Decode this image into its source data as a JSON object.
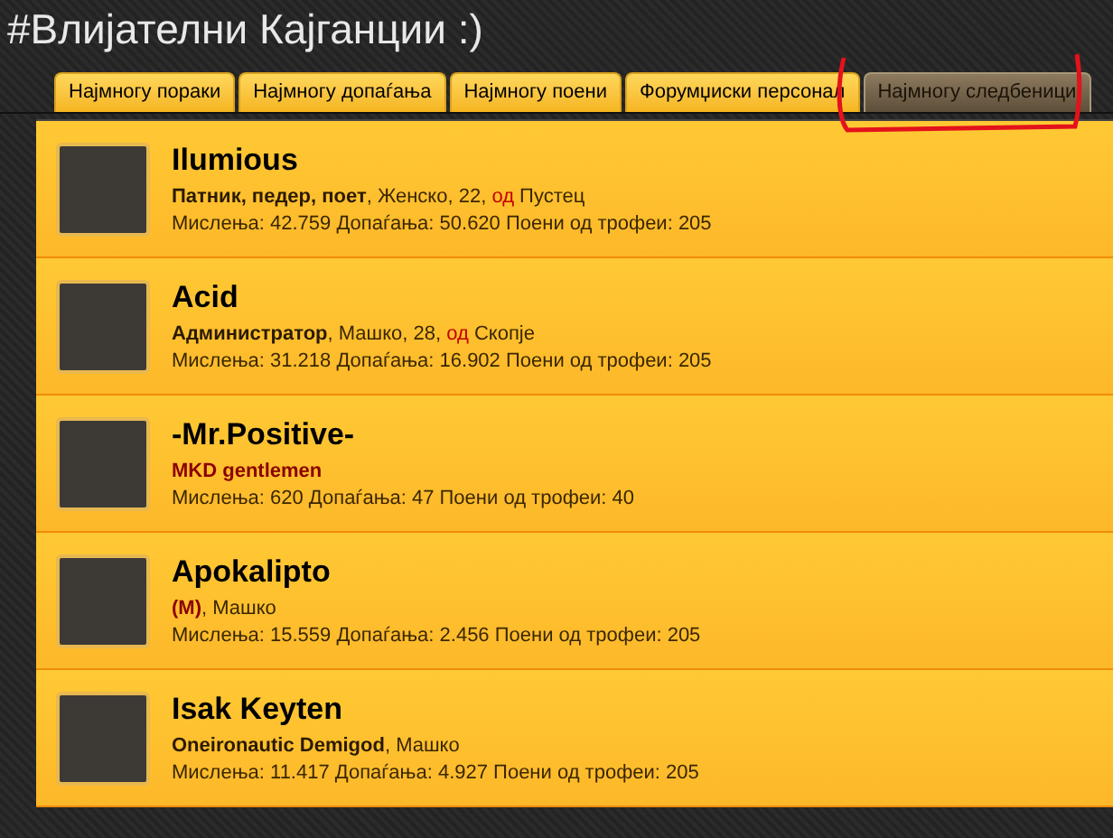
{
  "title": "#Влијателни Кајганции :)",
  "tabs": [
    {
      "label": "Најмногу пораки",
      "selected": false
    },
    {
      "label": "Најмногу допаѓања",
      "selected": false
    },
    {
      "label": "Најмногу поени",
      "selected": false
    },
    {
      "label": "Форумџиски персонал",
      "selected": false
    },
    {
      "label": "Најмногу следбеници",
      "selected": true
    }
  ],
  "users": [
    {
      "name": "Ilumious",
      "details": [
        {
          "kind": "title",
          "text": "Патник, педер, поет",
          "color": "#2a1a00"
        },
        {
          "kind": "text",
          "text": ", Женско, 22, "
        },
        {
          "kind": "from",
          "text": "од"
        },
        {
          "kind": "text",
          "text": " Пустец"
        }
      ],
      "stats": "Мислења: 42.759 Допаѓања: 50.620 Поени од трофеи: 205"
    },
    {
      "name": "Acid",
      "details": [
        {
          "kind": "title",
          "text": "Администратор",
          "color": "#2a1a00"
        },
        {
          "kind": "text",
          "text": ", Машко, 28, "
        },
        {
          "kind": "from",
          "text": "од"
        },
        {
          "kind": "text",
          "text": " Скопје"
        }
      ],
      "stats": "Мислења: 31.218 Допаѓања: 16.902 Поени од трофеи: 205"
    },
    {
      "name": "-Mr.Positive-",
      "details": [
        {
          "kind": "title",
          "text": "MKD gentlemen",
          "color": "#8b0000"
        }
      ],
      "stats": "Мислења: 620 Допаѓања: 47 Поени од трофеи: 40"
    },
    {
      "name": "Apokalipto",
      "details": [
        {
          "kind": "title",
          "text": "(M)",
          "color": "#8b0000"
        },
        {
          "kind": "text",
          "text": ", Машко"
        }
      ],
      "stats": "Мислења: 15.559 Допаѓања: 2.456 Поени од трофеи: 205"
    },
    {
      "name": "Isak Keyten",
      "details": [
        {
          "kind": "title",
          "text": "Oneironautic Demigod",
          "color": "#2a1a00"
        },
        {
          "kind": "text",
          "text": ", Машко"
        }
      ],
      "stats": "Мислења: 11.417 Допаѓања: 4.927 Поени од трофеи: 205"
    }
  ]
}
